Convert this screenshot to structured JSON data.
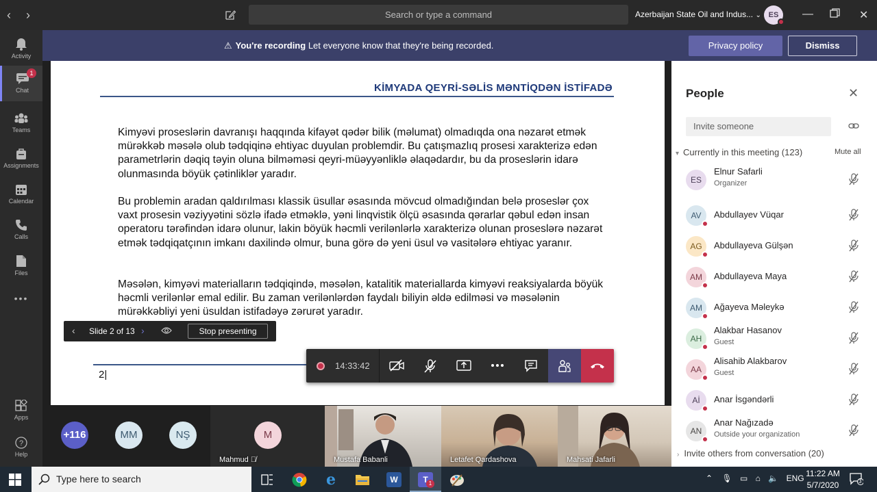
{
  "titlebar": {
    "search_placeholder": "Search or type a command",
    "org": "Azerbaijan State Oil and Indus...",
    "user_initials": "ES"
  },
  "rail": {
    "items": [
      {
        "label": "Activity",
        "icon": "bell-icon"
      },
      {
        "label": "Chat",
        "icon": "chat-icon",
        "badge": "1"
      },
      {
        "label": "Teams",
        "icon": "teams-icon"
      },
      {
        "label": "Assignments",
        "icon": "assignments-icon"
      },
      {
        "label": "Calendar",
        "icon": "calendar-icon"
      },
      {
        "label": "Calls",
        "icon": "phone-icon"
      },
      {
        "label": "Files",
        "icon": "file-icon"
      }
    ],
    "more": "•••",
    "bottom": [
      {
        "label": "Apps",
        "icon": "apps-icon"
      },
      {
        "label": "Help",
        "icon": "help-icon"
      }
    ]
  },
  "banner": {
    "strong": "You're recording",
    "text": "Let everyone know that they're being recorded.",
    "privacy": "Privacy policy",
    "dismiss": "Dismiss"
  },
  "slide": {
    "title": "KİMYADA QEYRİ-SƏLİS MƏNTİQDƏN İSTİFADƏ",
    "paragraphs": [
      "Kimyəvi proseslərin davranışı haqqında kifayət qədər bilik (məlumat) olmadıqda ona nəzarət etmək mürəkkəb məsələ olub tədqiqinə ehtiyac duyulan problemdir. Bu çatışmazlıq prosesi xarakterizə edən parametrlərin dəqiq təyin oluna bilməməsi qeyri-müəyyənliklə əlaqədardır, bu da proseslərin idarə olunmasında böyük çətinliklər yaradır.",
      " Bu problemin aradan qaldırılması klassik üsullar əsasında mövcud olmadığından belə proseslər çox vaxt prosesin vəziyyətini sözlə ifadə etməklə, yəni linqvistik ölçü əsasında qərarlar qəbul edən insan operatoru tərəfindən idarə olunur, lakin böyük həcmli verilənlərlə xarakterizə olunan proseslərə nəzarət etmək tədqiqatçının imkanı daxilində olmur, buna görə də yeni üsul və vasitələrə ehtiyac yaranır.",
      "Məsələn, kimyəvi materialların tədqiqində, məsələn, katalitik materiallarda kimyəvi reaksiyalarda böyük həcmli verilənlər emal edilir. Bu zaman verilənlərdən  faydalı biliyin əldə edilməsi və məsələnin mürəkkəbliyi yeni üsuldan istifadəyə zərurət  yaradır."
    ],
    "page_number": "2|"
  },
  "presenter": {
    "slide_count": "Slide 2 of 13",
    "stop": "Stop presenting"
  },
  "controls": {
    "timer": "14:33:42"
  },
  "gallery": {
    "overflow": "+116",
    "tiles": [
      "MM",
      "NŞ"
    ],
    "mahmud_initial": "M",
    "mahmud_name": "Mahmud",
    "videos": [
      "Mustafa Babanli",
      "Letafet Qardashova",
      "Mahsati Jafarli"
    ]
  },
  "people": {
    "title": "People",
    "invite_placeholder": "Invite someone",
    "section": "Currently in this meeting (123)",
    "mute_all": "Mute all",
    "list": [
      {
        "initials": "ES",
        "name": "Elnur Safarli",
        "role": "Organizer",
        "bg": "#e8dcee",
        "fg": "#4b3e57"
      },
      {
        "initials": "AV",
        "name": "Abdullayev Vüqar",
        "role": "",
        "bg": "#d9e7ef",
        "fg": "#3d5a70"
      },
      {
        "initials": "AG",
        "name": "Abdullayeva Gülşən",
        "role": "",
        "bg": "#fbe7c6",
        "fg": "#7a5a1e"
      },
      {
        "initials": "AM",
        "name": "Abdullayeva Maya",
        "role": "",
        "bg": "#f3d5db",
        "fg": "#7a3a48"
      },
      {
        "initials": "AM",
        "name": "Ağayeva Məleykə",
        "role": "",
        "bg": "#d9e7ef",
        "fg": "#3d5a70"
      },
      {
        "initials": "AH",
        "name": "Alakbar Hasanov",
        "role": "Guest",
        "bg": "#dbeedf",
        "fg": "#3b6a47"
      },
      {
        "initials": "AA",
        "name": "Alisahib Alakbarov",
        "role": "Guest",
        "bg": "#f3d5db",
        "fg": "#7a3a48"
      },
      {
        "initials": "Aİ",
        "name": "Anar İsgəndərli",
        "role": "",
        "bg": "#e8dcee",
        "fg": "#4b3e57"
      },
      {
        "initials": "AN",
        "name": "Anar Nağızadə",
        "role": "Outside your organization",
        "bg": "#e6e6e6",
        "fg": "#484644"
      }
    ],
    "invite_others": "Invite others from conversation (20)"
  },
  "taskbar": {
    "search_placeholder": "Type here to search",
    "lang": "ENG",
    "time": "11:22 AM",
    "date": "5/7/2020",
    "notifications": "3",
    "teams_badge": "1"
  },
  "colors": {
    "accent": "#6264a7",
    "banner": "#3b4069",
    "hangup": "#c4314b"
  }
}
